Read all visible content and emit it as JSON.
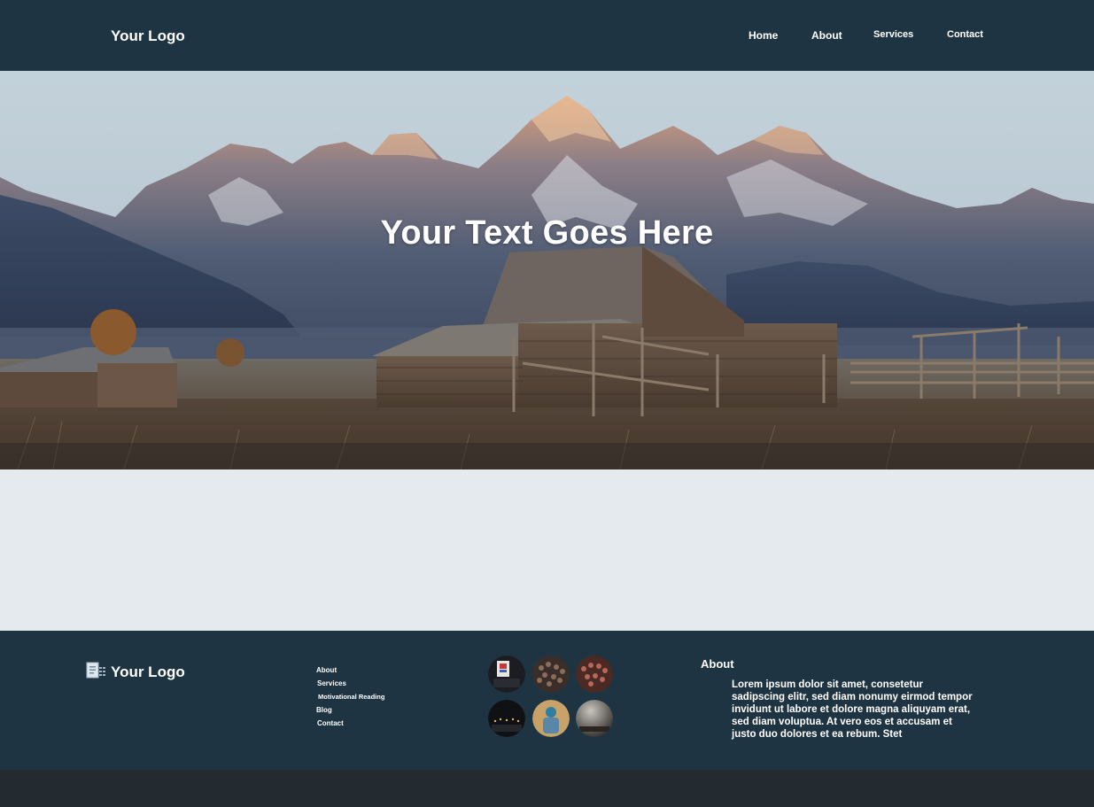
{
  "header": {
    "logo": "Your Logo",
    "nav": [
      "Home",
      "About",
      "Services",
      "Contact"
    ]
  },
  "hero": {
    "title": "Your Text Goes Here",
    "image": "mountain barn landscape"
  },
  "footer": {
    "logo": "Your Logo",
    "logo_icon": "document-icon",
    "links": [
      "About",
      "Services",
      "Motivational Reading",
      "Blog",
      "Contact"
    ],
    "thumbnails": [
      "event-photo-1",
      "crowd-photo-1",
      "crowd-photo-2",
      "stage-photo",
      "person-photo",
      "hall-photo"
    ],
    "about_heading": "About",
    "about_text": "Lorem ipsum dolor sit amet, consetetur sadipscing elitr, sed diam nonumy eirmod tempor invidunt ut labore et dolore magna aliquyam erat, sed diam voluptua. At vero eos et accusam et justo duo dolores et ea rebum. Stet"
  },
  "colors": {
    "header_bg": "#1f3443",
    "section_bg": "#e4eaee",
    "footer_bg": "#1f3443",
    "bottom_bg": "#232a30"
  }
}
